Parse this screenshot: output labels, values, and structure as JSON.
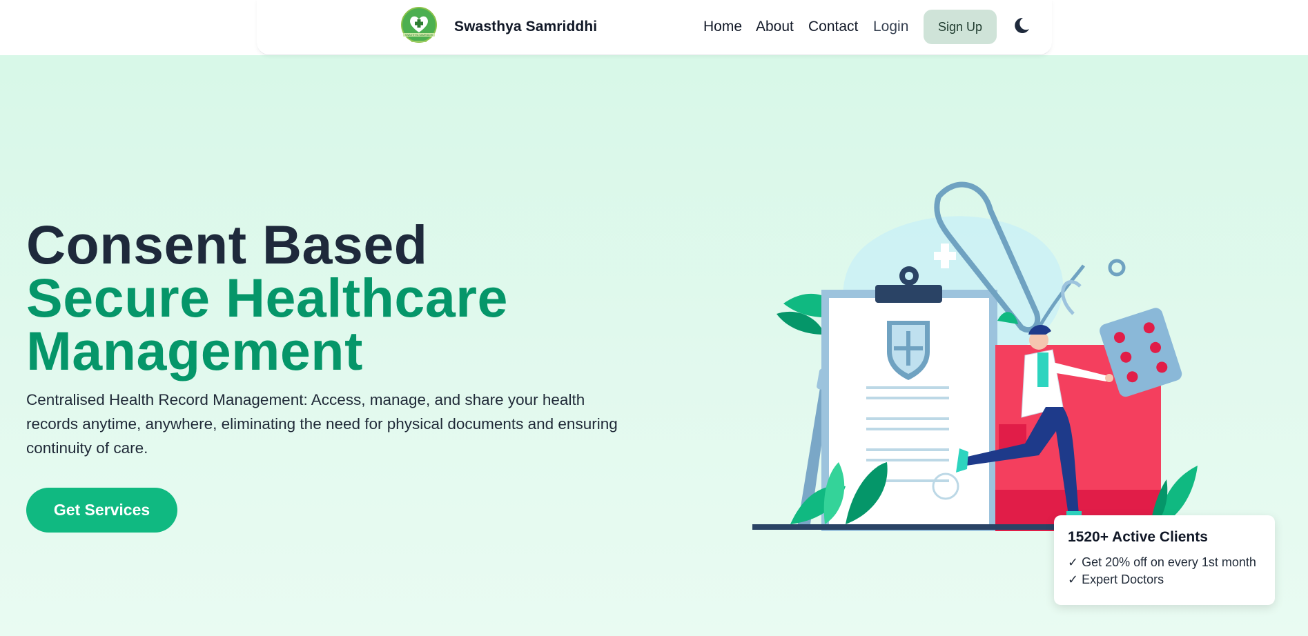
{
  "brand": {
    "name": "Swasthya Samriddhi",
    "logo_text": "SWASTHYA SAMRIDDHI"
  },
  "nav": {
    "links": [
      "Home",
      "About",
      "Contact",
      "Login"
    ],
    "signup_label": "Sign Up",
    "theme_icon": "moon-icon"
  },
  "hero": {
    "title_line1": "Consent Based",
    "title_line2": "Secure Healthcare",
    "title_line3": "Management",
    "description": "Centralised Health Record Management: Access, manage, and share your health records anytime, anywhere, eliminating the need for physical documents and ensuring continuity of care.",
    "cta_label": "Get Services"
  },
  "stats": {
    "title": "1520+ Active Clients",
    "items": [
      "✓ Get 20% off on every 1st month",
      "✓ Expert Doctors"
    ]
  },
  "colors": {
    "accent": "#10b981",
    "heading_green": "#059669",
    "heading_dark": "#1e293b",
    "background": "#d6f8e7",
    "signup_bg": "#cfe3d8"
  }
}
